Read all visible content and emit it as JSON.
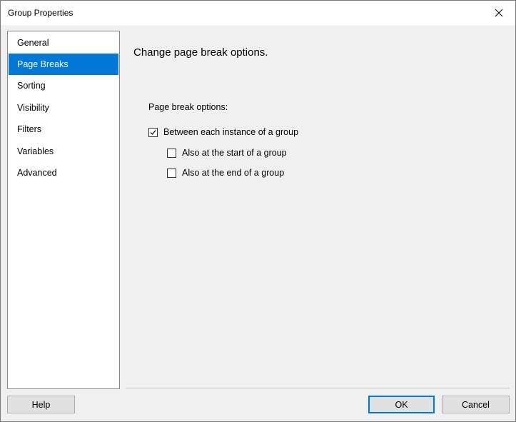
{
  "window": {
    "title": "Group Properties"
  },
  "nav": {
    "items": [
      {
        "label": "General"
      },
      {
        "label": "Page Breaks",
        "selected": true
      },
      {
        "label": "Sorting"
      },
      {
        "label": "Visibility"
      },
      {
        "label": "Filters"
      },
      {
        "label": "Variables"
      },
      {
        "label": "Advanced"
      }
    ]
  },
  "main": {
    "heading": "Change page break options.",
    "section_label": "Page break options:",
    "options": [
      {
        "label": "Between each instance of a group",
        "checked": true
      },
      {
        "label": "Also at the start of a group",
        "checked": false
      },
      {
        "label": "Also at the end of a group",
        "checked": false
      }
    ]
  },
  "footer": {
    "help_label": "Help",
    "ok_label": "OK",
    "cancel_label": "Cancel"
  },
  "colors": {
    "selection": "#0078d7",
    "background": "#f0f0f0"
  }
}
